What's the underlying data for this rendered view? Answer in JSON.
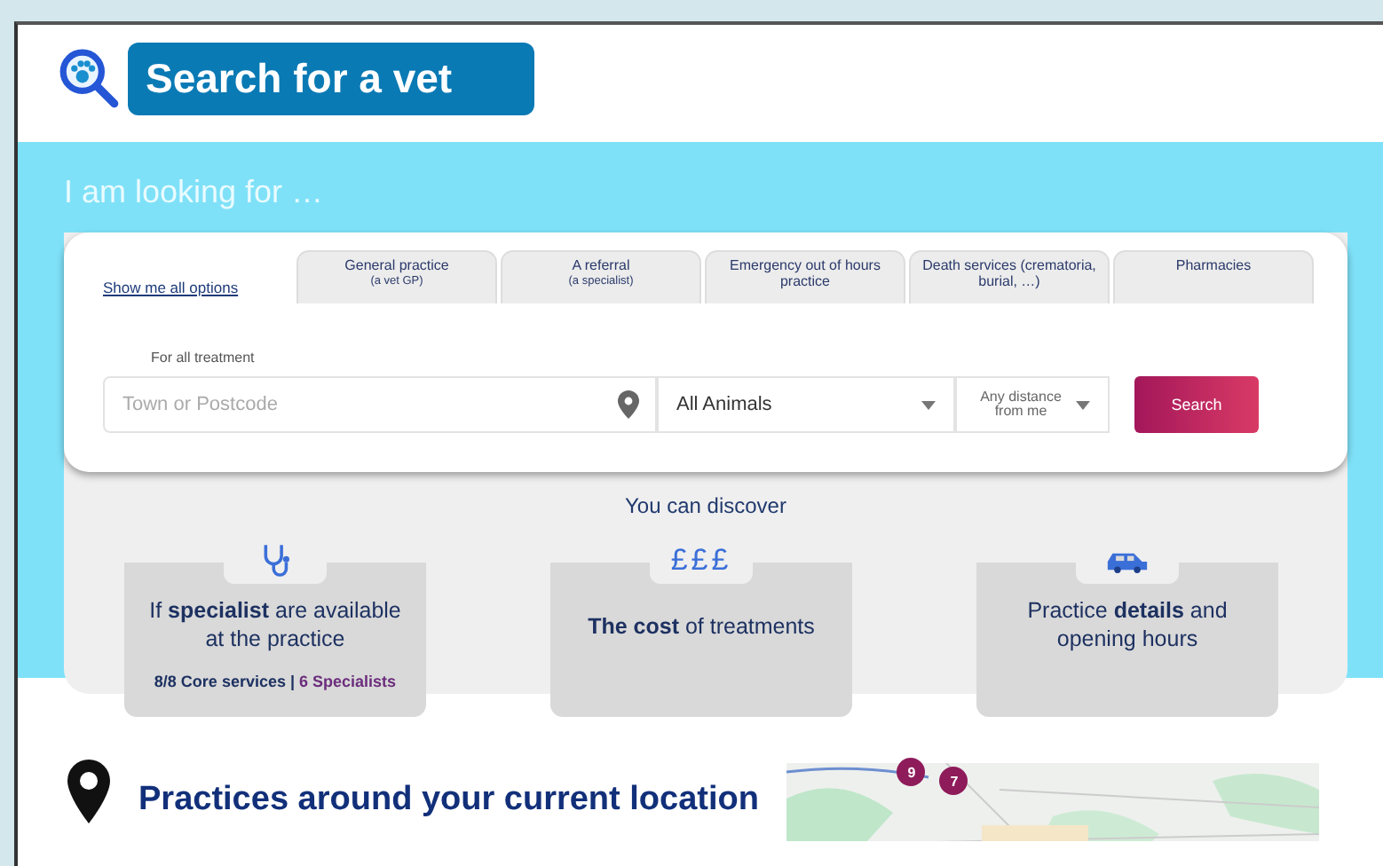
{
  "header": {
    "title": "Search for a vet"
  },
  "search_panel": {
    "heading": "I am looking for …",
    "all_options_link": "Show me all options",
    "tabs": [
      {
        "label": "General practice",
        "sublabel": "(a vet GP)",
        "selected": false
      },
      {
        "label": "A referral",
        "sublabel": "(a specialist)",
        "selected": false
      },
      {
        "label": "Emergency out of hours practice",
        "selected": false
      },
      {
        "label": "Death services (crematoria, burial, …)",
        "selected": false
      },
      {
        "label": "Pharmacies",
        "selected": false
      }
    ],
    "treatment_label": "For all treatment",
    "location_field": {
      "placeholder": "Town or Postcode"
    },
    "animal_select": {
      "value": "All Animals"
    },
    "distance_select": {
      "value": "Any distance from me"
    },
    "search_button": "Search"
  },
  "discover": {
    "heading": "You can discover",
    "cards": [
      {
        "kind": "stethoscope",
        "text": "If **specialist** are available at the practice",
        "footer_core": "8/8 Core services |",
        "footer_specialists": "6 Specialists"
      },
      {
        "kind": "pounds",
        "icon_text": "£££",
        "text": "**The cost** of treatments"
      },
      {
        "kind": "car",
        "text": "Practice **details** and opening hours"
      }
    ]
  },
  "nearby": {
    "heading": "Practices around your current location",
    "map": {
      "kind": "picture",
      "markers": [
        "9",
        "7"
      ]
    }
  }
}
